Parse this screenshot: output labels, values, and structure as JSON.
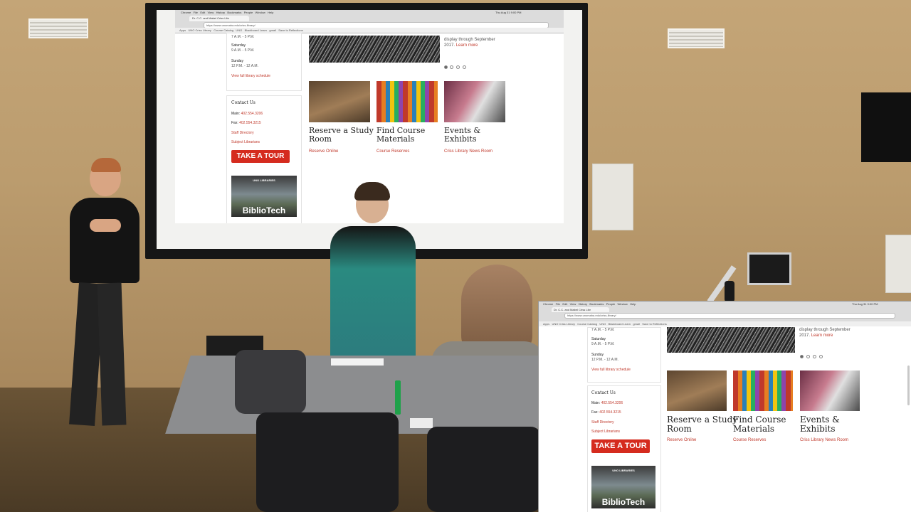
{
  "browser": {
    "app_menu": [
      "Chrome",
      "File",
      "Edit",
      "View",
      "History",
      "Bookmarks",
      "People",
      "Window",
      "Help"
    ],
    "tab_title": "Dr. C.C. and Mabel Criss Libr",
    "url": "https://www.unomaha.edu/criss-library/",
    "bookmarks": [
      "Apps",
      "UNO Criss Library",
      "Course Catalog",
      "UNO",
      "Blackboard Learn",
      "gmail",
      "Save to Reflections"
    ],
    "clock": "Thu Aug 31 9:00 PM"
  },
  "library_page": {
    "hours": {
      "weekday_end": "7 A.M. - 5 P.M.",
      "saturday_label": "Saturday",
      "saturday_hours": "9 A.M. - 5 P.M.",
      "sunday_label": "Sunday",
      "sunday_hours": "12 P.M. - 12 A.M.",
      "schedule_link": "View full library schedule"
    },
    "contact": {
      "heading": "Contact Us",
      "main_label": "Main:",
      "main_phone": "402.554.3206",
      "fax_label": "Fax:",
      "fax_phone": "402.554.3215",
      "staff_link": "Staff Directory",
      "subject_link": "Subject Librarians"
    },
    "tour_button": "TAKE A TOUR",
    "promo": {
      "banner_label": "UNO LIBRARIES",
      "title": "BiblioTech"
    },
    "hero_caption_1": "display through September",
    "hero_caption_2": "2017.",
    "hero_learn_more": "Learn more",
    "carousel_dots": 4,
    "carousel_active": 1,
    "tiles": [
      {
        "title_1": "Reserve a Study",
        "title_2": "Room",
        "link": "Reserve Online",
        "icon": "study-room-photo"
      },
      {
        "title_1": "Find Course",
        "title_2": "Materials",
        "link": "Course Reserves",
        "icon": "bookshelf-photo"
      },
      {
        "title_1": "Events &",
        "title_2": "Exhibits",
        "link": "Criss Library News Room",
        "icon": "event-photo"
      }
    ]
  },
  "colors": {
    "accent_red": "#d52b1e",
    "link_red": "#c0392b",
    "wall": "#c4a577"
  }
}
